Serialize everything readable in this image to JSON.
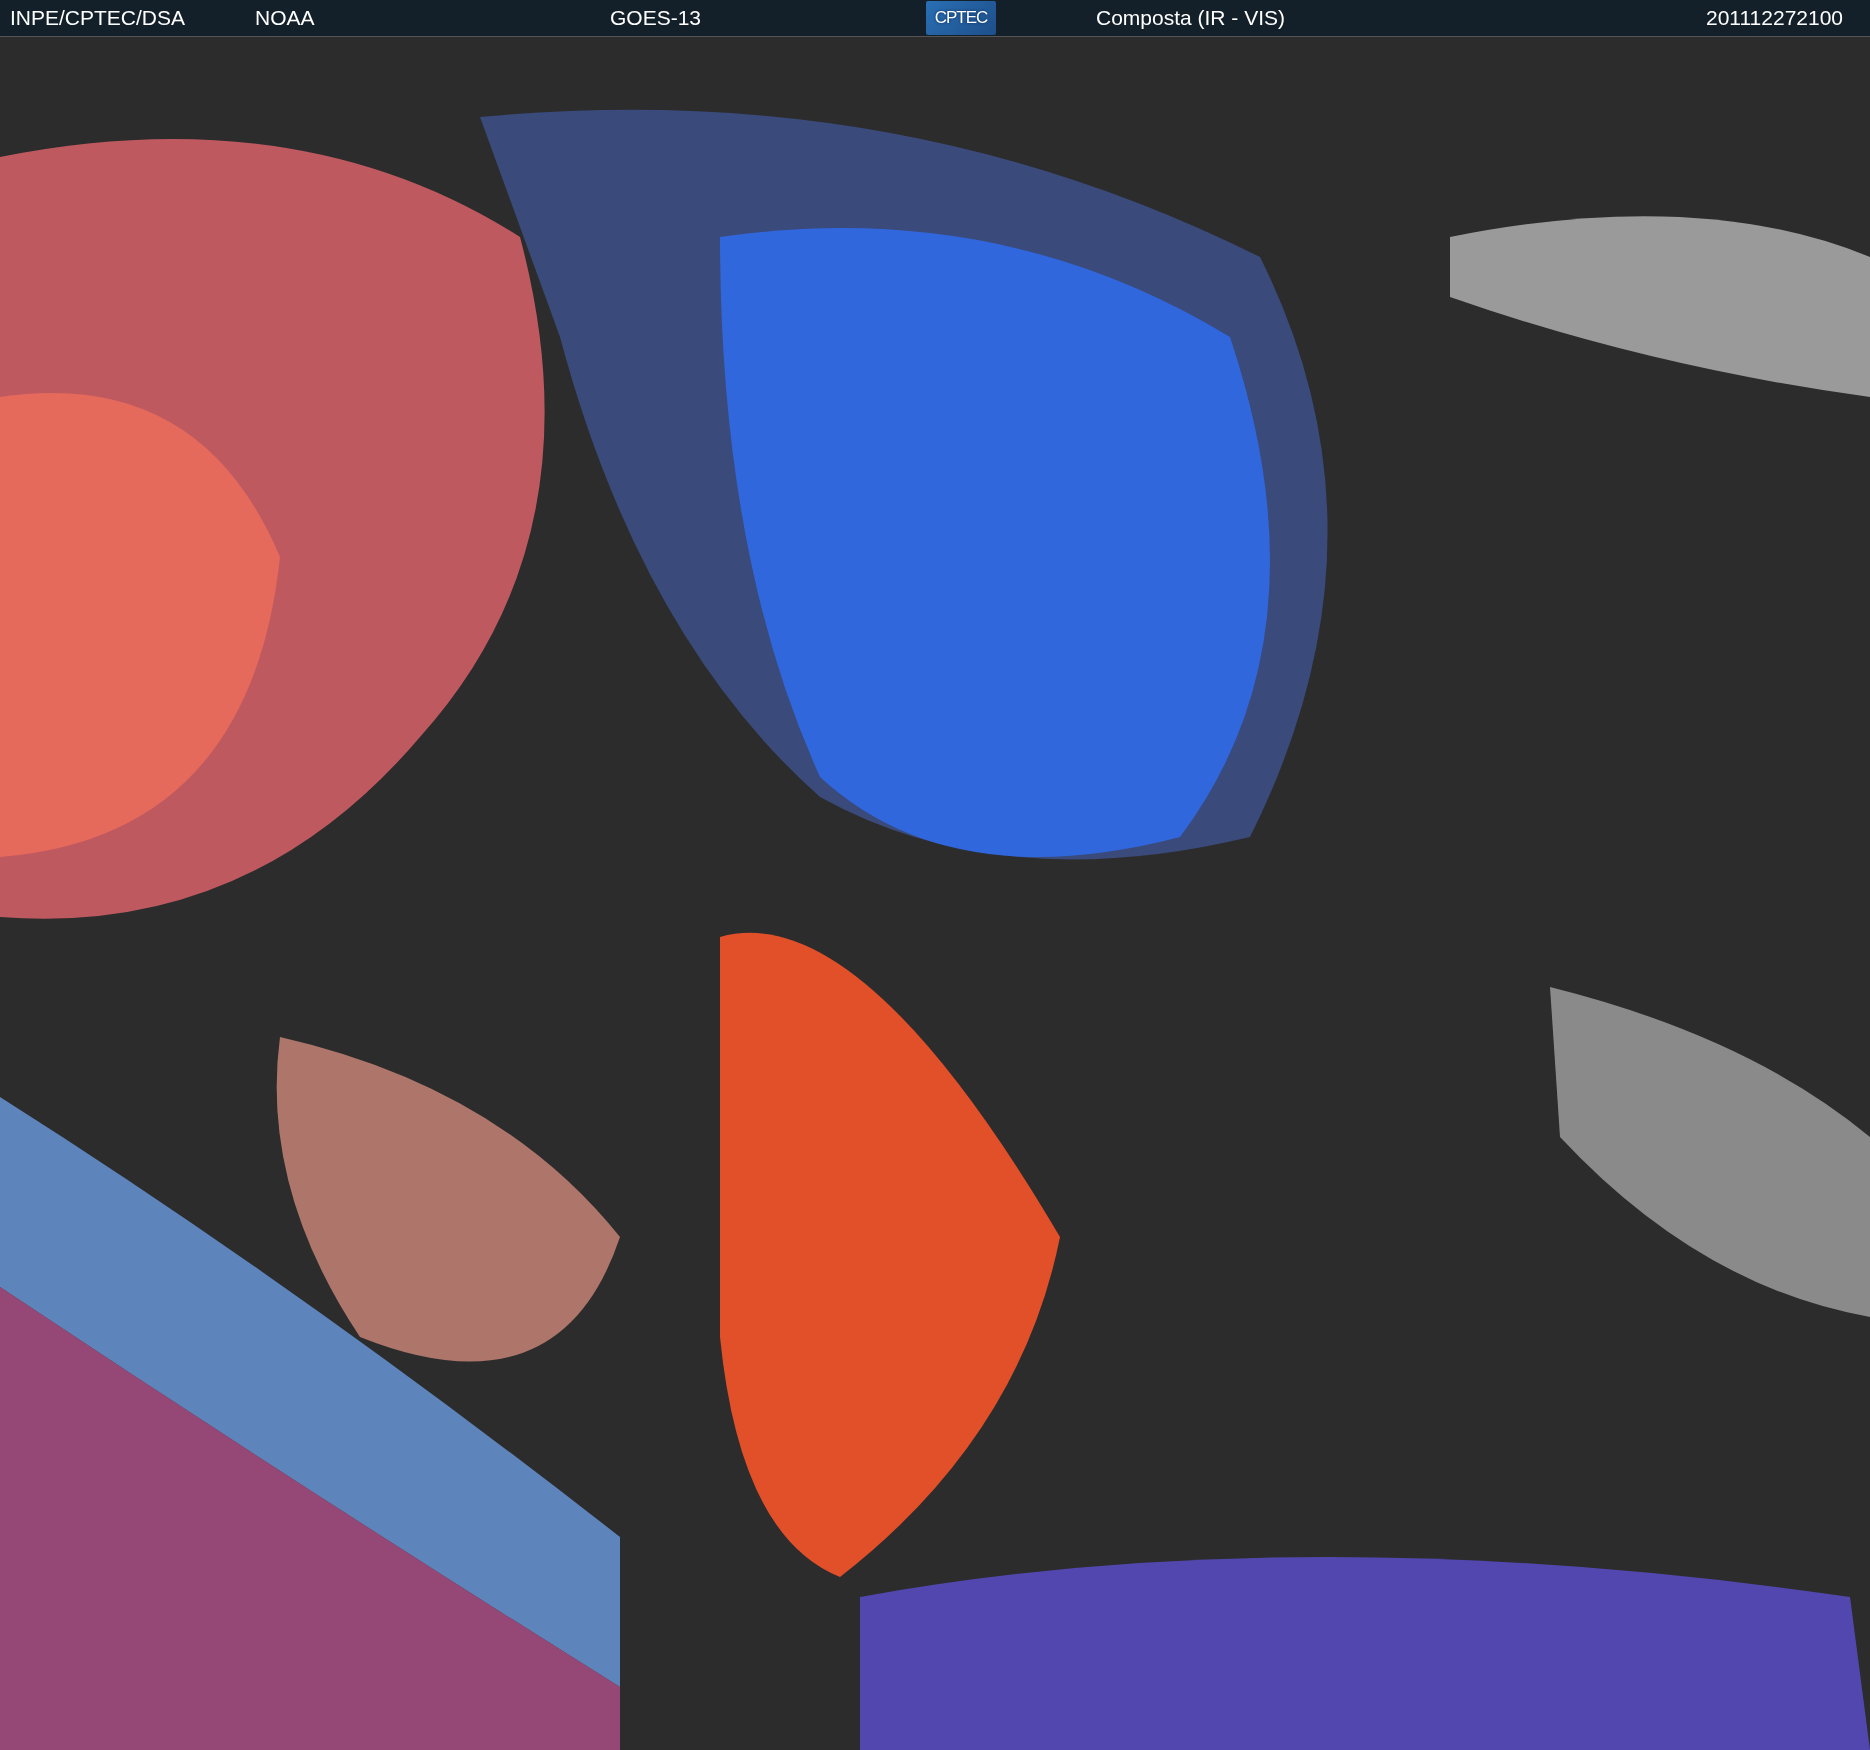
{
  "header": {
    "source": "INPE/CPTEC/DSA",
    "agency": "NOAA",
    "satellite": "GOES-13",
    "logo": {
      "text": "CPTEC"
    },
    "product": "Composta (IR - VIS)",
    "timestamp": "201112272100"
  }
}
